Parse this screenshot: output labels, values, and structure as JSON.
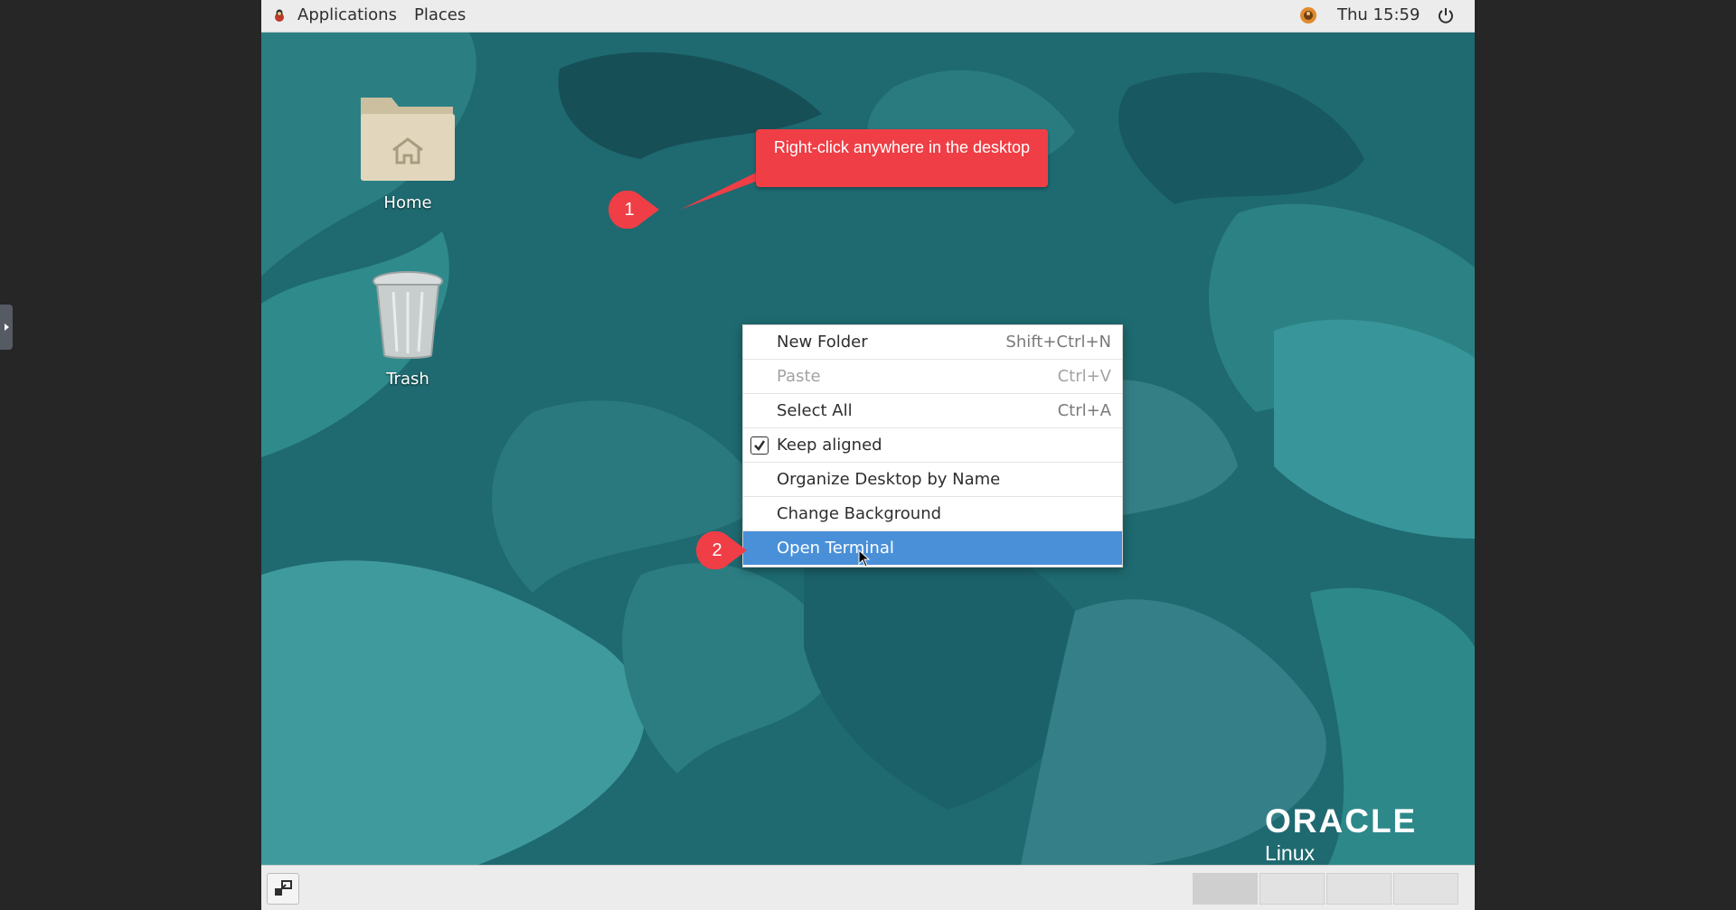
{
  "topbar": {
    "applications_label": "Applications",
    "places_label": "Places",
    "clock": "Thu 15:59"
  },
  "desktop": {
    "icons": [
      {
        "label": "Home"
      },
      {
        "label": "Trash"
      }
    ]
  },
  "context_menu": {
    "items": [
      {
        "label": "New Folder",
        "shortcut": "Shift+Ctrl+N"
      },
      {
        "label": "Paste",
        "shortcut": "Ctrl+V"
      },
      {
        "label": "Select All",
        "shortcut": "Ctrl+A"
      },
      {
        "label": "Keep aligned"
      },
      {
        "label": "Organize Desktop by Name"
      },
      {
        "label": "Change Background"
      },
      {
        "label": "Open Terminal"
      }
    ]
  },
  "annotations": {
    "step1_number": "1",
    "step1_text": "Right-click anywhere in the desktop",
    "step2_number": "2"
  },
  "branding": {
    "word": "ORACLE",
    "sub": "Linux"
  },
  "colors": {
    "desktop_teal": "#1e6a70",
    "menu_highlight": "#4a90d9",
    "callout_red": "#ef3e45"
  }
}
